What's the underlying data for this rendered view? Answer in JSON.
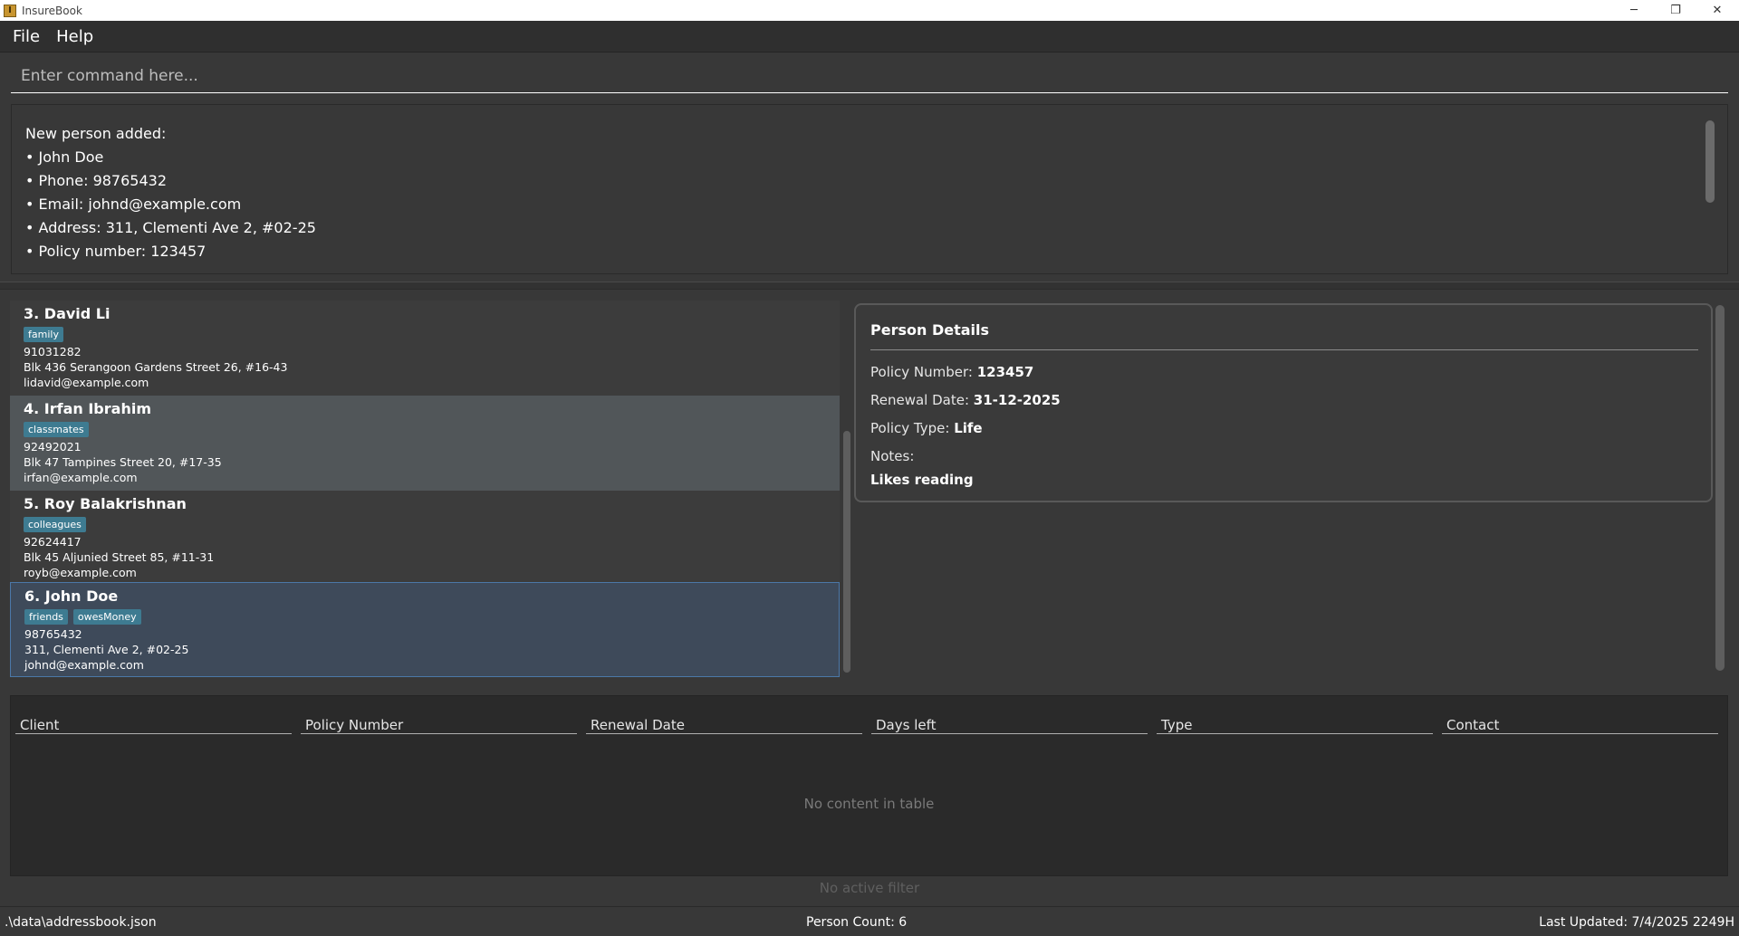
{
  "window": {
    "title": "InsureBook",
    "app_icon_glyph": "I",
    "minimize_glyph": "─",
    "maximize_glyph": "❐",
    "close_glyph": "✕"
  },
  "menu": {
    "items": [
      "File",
      "Help"
    ]
  },
  "command": {
    "placeholder": "Enter command here..."
  },
  "result": {
    "lines": [
      "New person added:",
      "• John Doe",
      "• Phone: 98765432",
      "• Email: johnd@example.com",
      "• Address: 311, Clementi Ave 2, #02-25",
      "• Policy number: 123457"
    ]
  },
  "persons": [
    {
      "name": "3. David Li",
      "tags": [
        "family"
      ],
      "phone": "91031282",
      "address": "Blk 436 Serangoon Gardens Street 26, #16-43",
      "email": "lidavid@example.com"
    },
    {
      "name": "4. Irfan Ibrahim",
      "tags": [
        "classmates"
      ],
      "phone": "92492021",
      "address": "Blk 47 Tampines Street 20, #17-35",
      "email": "irfan@example.com"
    },
    {
      "name": "5. Roy Balakrishnan",
      "tags": [
        "colleagues"
      ],
      "phone": "92624417",
      "address": "Blk 45 Aljunied Street 85, #11-31",
      "email": "royb@example.com"
    },
    {
      "name": "6. John Doe",
      "tags": [
        "friends",
        "owesMoney"
      ],
      "phone": "98765432",
      "address": "311, Clementi Ave 2, #02-25",
      "email": "johnd@example.com"
    }
  ],
  "details": {
    "heading": "Person Details",
    "policy_number_label": "Policy Number:",
    "policy_number": "123457",
    "renewal_date_label": "Renewal Date:",
    "renewal_date": "31-12-2025",
    "policy_type_label": "Policy Type:",
    "policy_type": "Life",
    "notes_label": "Notes:",
    "notes": "Likes reading"
  },
  "table": {
    "columns": [
      "Client",
      "Policy Number",
      "Renewal Date",
      "Days left",
      "Type",
      "Contact"
    ],
    "empty_text": "No content in table"
  },
  "filter_text": "No active filter",
  "status": {
    "file_path": ".\\data\\addressbook.json",
    "person_count": "Person Count: 6",
    "last_updated": "Last Updated: 7/4/2025 2249H"
  },
  "colors": {
    "tag": "#3e7b91",
    "selected_card": "#3e4a5a",
    "hover_card": "#515659",
    "background": "#383838"
  }
}
